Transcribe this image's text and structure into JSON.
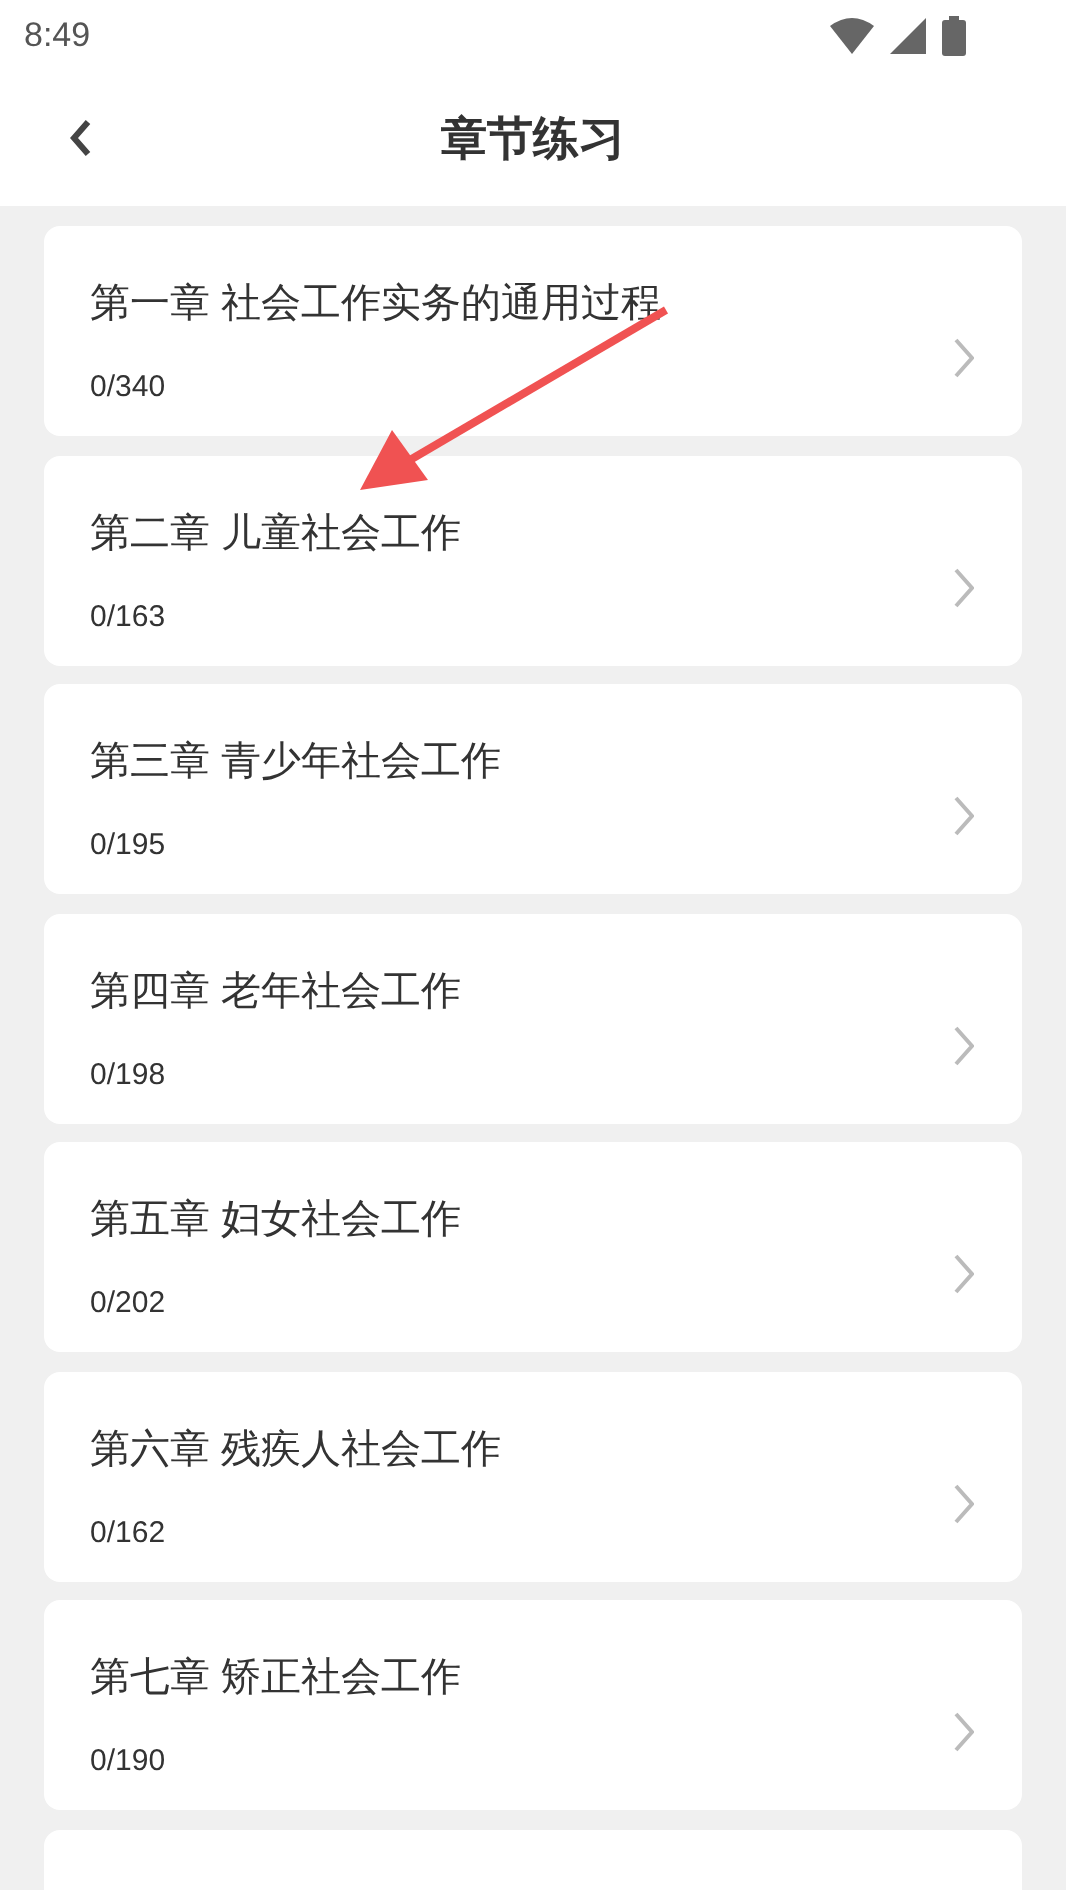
{
  "status_bar": {
    "time": "8:49"
  },
  "header": {
    "title": "章节练习"
  },
  "chapters": [
    {
      "title": "第一章 社会工作实务的通用过程",
      "progress": "0/340"
    },
    {
      "title": "第二章 儿童社会工作",
      "progress": "0/163"
    },
    {
      "title": "第三章 青少年社会工作",
      "progress": "0/195"
    },
    {
      "title": "第四章 老年社会工作",
      "progress": "0/198"
    },
    {
      "title": "第五章 妇女社会工作",
      "progress": "0/202"
    },
    {
      "title": "第六章 残疾人社会工作",
      "progress": "0/162"
    },
    {
      "title": "第七章 矫正社会工作",
      "progress": "0/190"
    }
  ],
  "more_below": true
}
